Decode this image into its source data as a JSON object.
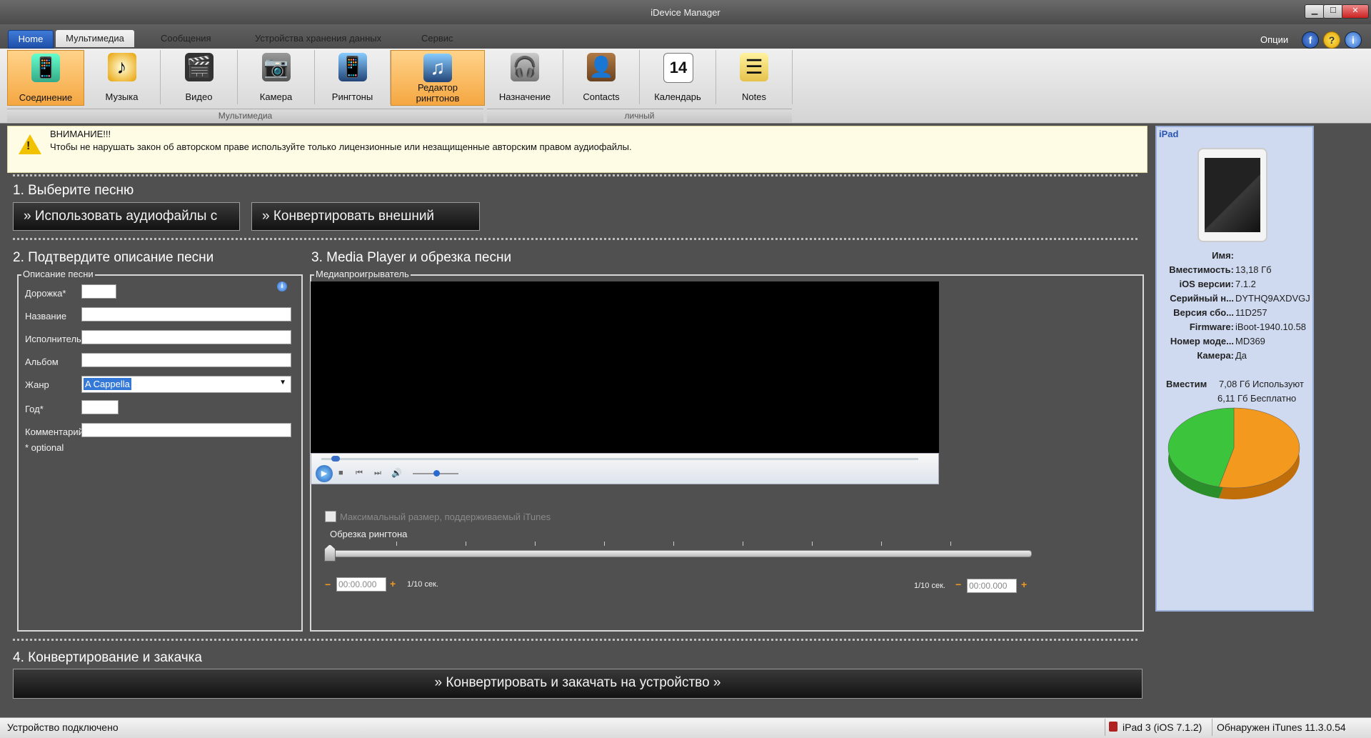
{
  "window": {
    "title": "iDevice Manager",
    "min": "▁",
    "max": "☐",
    "close": "✕"
  },
  "menu": {
    "tabs": [
      {
        "label": "Home"
      },
      {
        "label": "Мультимедиа"
      },
      {
        "label": "Сообщения"
      },
      {
        "label": "Устройства хранения данных"
      },
      {
        "label": "Сервис"
      }
    ],
    "options_label": "Опции",
    "icons": {
      "facebook": "f",
      "help": "?",
      "info": "i"
    }
  },
  "ribbon": {
    "multimedia_group": "Мультимедиа",
    "personal_group": "личный",
    "buttons": [
      {
        "label": "Соединение",
        "icon": "connection-icon"
      },
      {
        "label": "Музыка",
        "icon": "music-icon"
      },
      {
        "label": "Видео",
        "icon": "video-icon"
      },
      {
        "label": "Камера",
        "icon": "camera-icon"
      },
      {
        "label": "Рингтоны",
        "icon": "ringtones-icon"
      },
      {
        "label": "Редактор рингтонов",
        "icon": "ringtone-editor-icon"
      },
      {
        "label": "Назначение",
        "icon": "assignment-icon"
      },
      {
        "label": "Contacts",
        "icon": "contacts-icon"
      },
      {
        "label": "Календарь",
        "icon": "calendar-icon",
        "day": "14"
      },
      {
        "label": "Notes",
        "icon": "notes-icon"
      }
    ]
  },
  "warning": {
    "title": "ВНИМАНИЕ!!!",
    "text": "Чтобы не нарушать закон об авторском праве используйте только лицензионные или незащищенные авторским правом аудиофайлы."
  },
  "step1": {
    "heading": "1. Выберите песню",
    "use_button": "» Использовать аудиофайлы с",
    "convert_button": "» Конвертировать внешний"
  },
  "step2": {
    "heading": "2. Подтвердите описание песни",
    "panel_title": "Описание песни",
    "fields": {
      "track": "Дорожка*",
      "title": "Название",
      "artist": "Исполнитель",
      "album": "Альбом",
      "genre": "Жанр",
      "year": "Год*",
      "comment": "Комментарий"
    },
    "genre_value": "A Cappella",
    "optional_note": "* optional"
  },
  "step3": {
    "heading": "3. Media Player и обрезка песни",
    "player_title": "Медиапроигрыватель",
    "max_size_label": "Максимальный размер, поддерживаемый iTunes",
    "trim_label": "Обрезка рингтона",
    "start_time": "00:00.000",
    "end_time": "00:00.000",
    "step_label_left": "1/10 сек.",
    "step_label_right": "1/10 сек."
  },
  "step4": {
    "heading": "4. Конвертирование и закачка",
    "button": "» Конвертировать и закачать на устройство »"
  },
  "device": {
    "title": "iPad",
    "rows": [
      {
        "key": "Имя:",
        "value": ""
      },
      {
        "key": "Вместимость:",
        "value": "13,18 Гб"
      },
      {
        "key": "iOS версии:",
        "value": "7.1.2"
      },
      {
        "key": "Серийный н...",
        "value": "DYTHQ9AXDVGJ"
      },
      {
        "key": "Версия сбо...",
        "value": "11D257"
      },
      {
        "key": "Firmware:",
        "value": "iBoot-1940.10.58"
      },
      {
        "key": "Номер моде...",
        "value": "MD369"
      },
      {
        "key": "Камера:",
        "value": "Да"
      }
    ],
    "capacity_key": "Вместим",
    "used_text": "7,08 Гб Используют",
    "free_text": "6,11 Гб Бесплатно",
    "chart_data": {
      "type": "pie",
      "categories": [
        "Используют",
        "Бесплатно"
      ],
      "values": [
        7.08,
        6.11
      ],
      "colors": [
        "#f39a1e",
        "#3cc43c"
      ]
    }
  },
  "status": {
    "left": "Устройство подключено",
    "device": "iPad 3 (iOS  7.1.2)",
    "itunes": "Обнаружен iTunes 11.3.0.54"
  }
}
